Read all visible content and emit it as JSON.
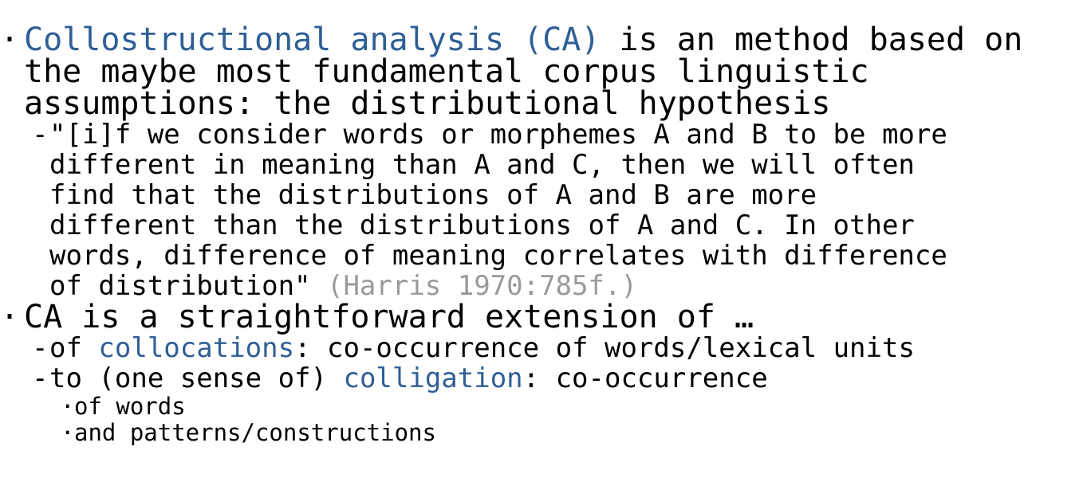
{
  "colors": {
    "text": "#000000",
    "accent": "#2e5f95",
    "citation": "#9a9a9a"
  },
  "bullets": {
    "level1_marker": "·",
    "level2_marker": "-",
    "level3_marker": "·"
  },
  "p1": {
    "term": "Collostructional analysis (CA)",
    "line1_rest": " is an method based on",
    "line2": "the maybe most fundamental corpus linguistic",
    "line3": "assumptions: the distributional hypothesis"
  },
  "quote": {
    "line1": "\"[i]f we consider words or morphemes A and B to be more",
    "line2": "different in meaning than A and C, then we will often",
    "line3": "find that the distributions of A and B are more",
    "line4": "different than the distributions of A and C. In other",
    "line5": "words, difference of meaning correlates with difference",
    "line6": "of distribution\"",
    "citation": " (Harris 1970:785f.)"
  },
  "p2": {
    "text": "CA is a straightforward extension of …"
  },
  "sub1": {
    "prefix": "of ",
    "term": "collocations",
    "rest": ": co-occurrence of words/lexical units"
  },
  "sub2": {
    "prefix": "to (one sense of) ",
    "term": "colligation",
    "rest": ": co-occurrence"
  },
  "sub2_items": [
    "of words",
    "and patterns/constructions"
  ]
}
